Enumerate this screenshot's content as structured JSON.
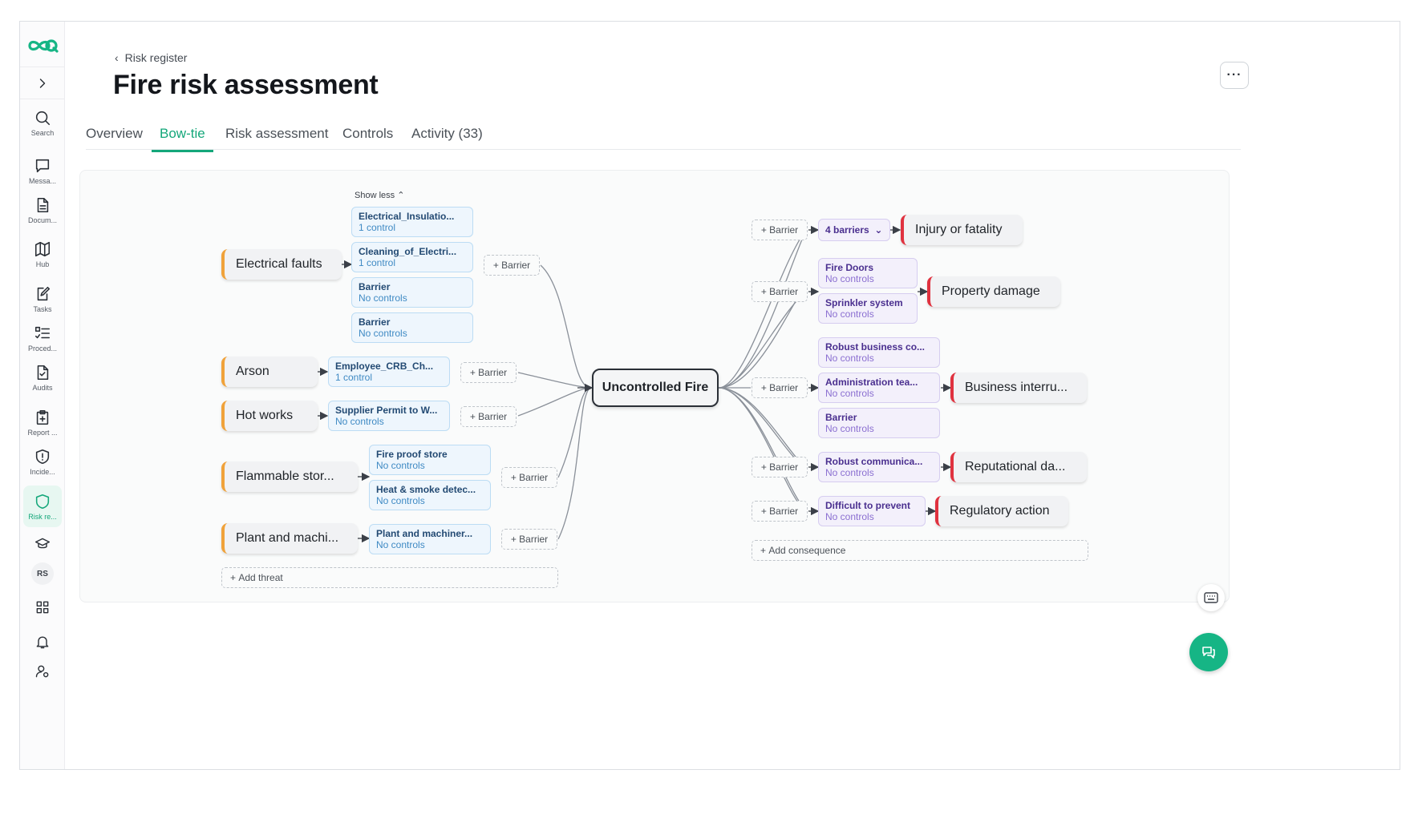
{
  "sidebar": {
    "expand_icon": "chevron-right-icon",
    "items": [
      {
        "label": "Search",
        "icon": "search-icon"
      },
      {
        "label": "Messa...",
        "icon": "message-icon"
      },
      {
        "label": "Docum...",
        "icon": "document-icon"
      },
      {
        "label": "Hub",
        "icon": "map-icon"
      },
      {
        "label": "Tasks",
        "icon": "task-icon"
      },
      {
        "label": "Proced...",
        "icon": "list-icon"
      },
      {
        "label": "Audits",
        "icon": "audit-icon"
      },
      {
        "label": "Report ...",
        "icon": "report-icon"
      },
      {
        "label": "Incide...",
        "icon": "incident-icon"
      },
      {
        "label": "Risk re...",
        "icon": "shield-icon"
      }
    ],
    "avatar": "RS",
    "accent": "#14a77a"
  },
  "header": {
    "breadcrumb": "Risk register",
    "title": "Fire risk assessment",
    "more": "···"
  },
  "tabs": [
    {
      "label": "Overview"
    },
    {
      "label": "Bow-tie"
    },
    {
      "label": "Risk assessment"
    },
    {
      "label": "Controls"
    },
    {
      "label": "Activity (33)"
    }
  ],
  "bowtie": {
    "show_less": "Show less",
    "center": "Uncontrolled Fire",
    "add_barrier": "Barrier",
    "add_threat": "Add threat",
    "add_consequence": "Add consequence",
    "threats": [
      {
        "label": "Electrical faults"
      },
      {
        "label": "Arson"
      },
      {
        "label": "Hot works"
      },
      {
        "label": "Flammable stor..."
      },
      {
        "label": "Plant and machi..."
      }
    ],
    "threat_barriers": [
      {
        "title": "Electrical_Insulatio...",
        "sub": "1 control"
      },
      {
        "title": "Cleaning_of_Electri...",
        "sub": "1 control"
      },
      {
        "title": "Barrier",
        "sub": "No controls"
      },
      {
        "title": "Barrier",
        "sub": "No controls"
      },
      {
        "title": "Employee_CRB_Ch...",
        "sub": "1 control"
      },
      {
        "title": "Supplier Permit to W...",
        "sub": "No controls"
      },
      {
        "title": "Fire proof store",
        "sub": "No controls"
      },
      {
        "title": "Heat & smoke detec...",
        "sub": "No controls"
      },
      {
        "title": "Plant and machiner...",
        "sub": "No controls"
      }
    ],
    "consequences": [
      {
        "label": "Injury or fatality"
      },
      {
        "label": "Property damage"
      },
      {
        "label": "Business interru..."
      },
      {
        "label": "Reputational da..."
      },
      {
        "label": "Regulatory action"
      }
    ],
    "collapsed_group": "4 barriers",
    "consequence_barriers": [
      {
        "title": "Fire Doors",
        "sub": "No controls"
      },
      {
        "title": "Sprinkler system",
        "sub": "No controls"
      },
      {
        "title": "Robust business co...",
        "sub": "No controls"
      },
      {
        "title": "Administration tea...",
        "sub": "No controls"
      },
      {
        "title": "Barrier",
        "sub": "No controls"
      },
      {
        "title": "Robust communica...",
        "sub": "No controls"
      },
      {
        "title": "Difficult to prevent",
        "sub": "No controls"
      }
    ],
    "colors": {
      "threat_accent": "#f0a23a",
      "consequence_accent": "#e0323f",
      "preventive_barrier": "#eef6fd",
      "mitigating_barrier": "#f3f0fb"
    }
  }
}
